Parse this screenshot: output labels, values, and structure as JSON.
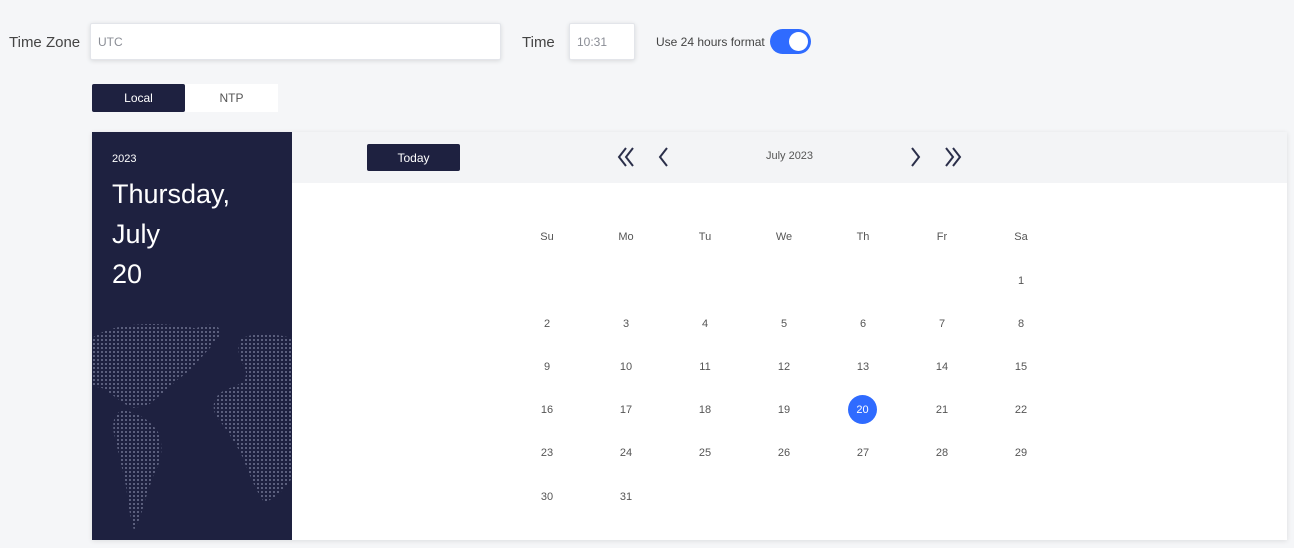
{
  "settings": {
    "timezone_label": "Time Zone",
    "timezone_value": "UTC",
    "time_label": "Time",
    "time_value": "10:31",
    "format_label": "Use 24 hours format",
    "format_enabled": true
  },
  "tabs": [
    {
      "label": "Local",
      "active": true
    },
    {
      "label": "NTP",
      "active": false
    }
  ],
  "calendar": {
    "side_year": "2023",
    "side_weekday": "Thursday,",
    "side_month": "July",
    "side_day": "20",
    "today_label": "Today",
    "month_label": "July 2023",
    "weekdays": [
      "Su",
      "Mo",
      "Tu",
      "We",
      "Th",
      "Fr",
      "Sa"
    ],
    "weeks": [
      [
        "",
        "",
        "",
        "",
        "",
        "",
        "1"
      ],
      [
        "2",
        "3",
        "4",
        "5",
        "6",
        "7",
        "8"
      ],
      [
        "9",
        "10",
        "11",
        "12",
        "13",
        "14",
        "15"
      ],
      [
        "16",
        "17",
        "18",
        "19",
        "20",
        "21",
        "22"
      ],
      [
        "23",
        "24",
        "25",
        "26",
        "27",
        "28",
        "29"
      ],
      [
        "30",
        "31",
        "",
        "",
        "",
        "",
        ""
      ]
    ],
    "selected_day": "20"
  },
  "colors": {
    "accent": "#2f6bff",
    "dark": "#1e2140"
  }
}
